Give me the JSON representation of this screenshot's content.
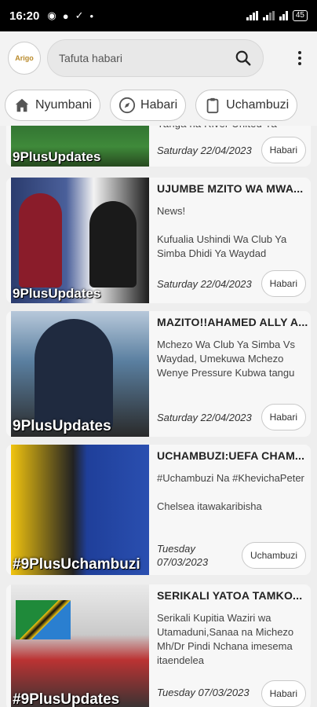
{
  "status": {
    "time": "16:20",
    "battery": "45"
  },
  "header": {
    "logo_text": "Arigo",
    "search_placeholder": "Tafuta habari"
  },
  "tabs": [
    {
      "label": "Nyumbani",
      "icon": "home-icon"
    },
    {
      "label": "Habari",
      "icon": "compass-icon"
    },
    {
      "label": "Uchambuzi",
      "icon": "clipboard-icon"
    }
  ],
  "articles": [
    {
      "title": "Yanga na River United Ya",
      "desc": "",
      "date": "Saturday 22/04/2023",
      "category": "Habari",
      "tag": "9PlusUpdates"
    },
    {
      "title": "UJUMBE MZITO WA MWA...",
      "desc": "News!\n\nKufualia Ushindi Wa Club Ya Simba Dhidi Ya Waydad",
      "date": "Saturday 22/04/2023",
      "category": "Habari",
      "tag": "9PlusUpdates"
    },
    {
      "title": "MAZITO!!AHAMED ALLY A...",
      "desc": "Mchezo Wa Club Ya Simba Vs Waydad, Umekuwa Mchezo Wenye Pressure Kubwa tangu",
      "date": "Saturday 22/04/2023",
      "category": "Habari",
      "tag": "9PlusUpdates"
    },
    {
      "title": "UCHAMBUZI:UEFA CHAM...",
      "desc": "#Uchambuzi Na #KhevichaPeter\n\nChelsea itawakaribisha",
      "date": "Tuesday 07/03/2023",
      "category": "Uchambuzi",
      "tag": "#9PlusUchambuzi"
    },
    {
      "title": "SERIKALI YATOA TAMKO...",
      "desc": "Serikali Kupitia Waziri wa Utamaduni,Sanaa na Michezo Mh/Dr Pindi Nchana imesema itaendelea",
      "date": "Tuesday 07/03/2023",
      "category": "Habari",
      "tag": "#9PlusUpdates"
    }
  ],
  "colors": {
    "status_bar": "#000000",
    "background": "#eeeeee",
    "card": "#f7f7f7"
  }
}
